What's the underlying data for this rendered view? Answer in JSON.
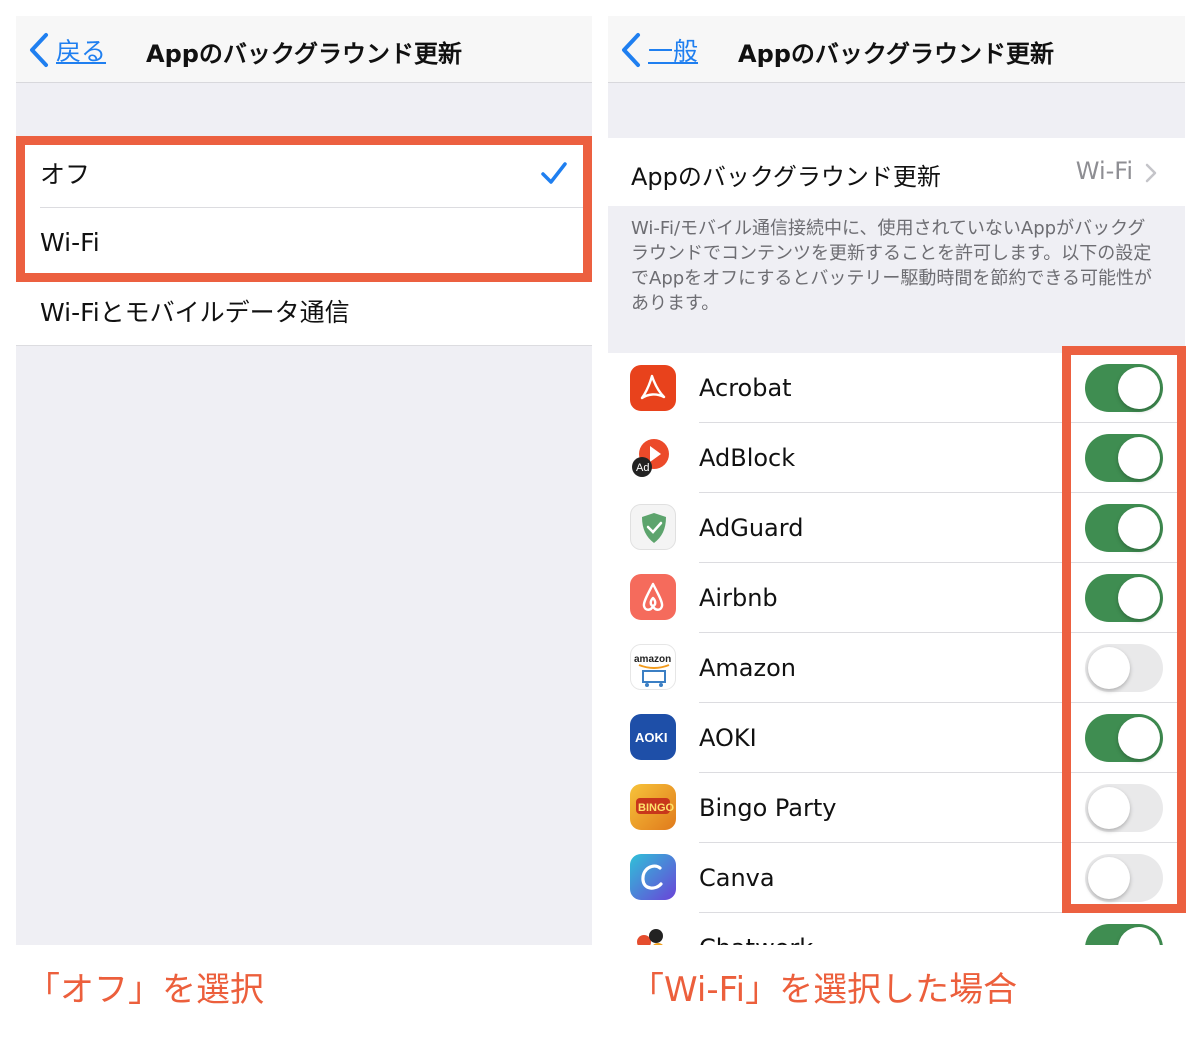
{
  "left_screen": {
    "back_label": "戻る",
    "title": "Appのバックグラウンド更新",
    "options": [
      {
        "label": "オフ",
        "checked": true
      },
      {
        "label": "Wi-Fi",
        "checked": false
      },
      {
        "label": "Wi-Fiとモバイルデータ通信",
        "checked": false
      }
    ]
  },
  "right_screen": {
    "back_label": "一般",
    "title": "Appのバックグラウンド更新",
    "setting": {
      "label": "Appのバックグラウンド更新",
      "value": "Wi-Fi"
    },
    "note": "Wi-Fi/モバイル通信接続中に、使用されていないAppがバックグラウンドでコンテンツを更新することを許可します。以下の設定でAppをオフにするとバッテリー駆動時間を節約できる可能性があります。",
    "apps": [
      {
        "name": "Acrobat",
        "enabled": true,
        "icon": "acrobat-icon"
      },
      {
        "name": "AdBlock",
        "enabled": true,
        "icon": "adblock-icon"
      },
      {
        "name": "AdGuard",
        "enabled": true,
        "icon": "adguard-icon"
      },
      {
        "name": "Airbnb",
        "enabled": true,
        "icon": "airbnb-icon"
      },
      {
        "name": "Amazon",
        "enabled": false,
        "icon": "amazon-icon"
      },
      {
        "name": "AOKI",
        "enabled": true,
        "icon": "aoki-icon"
      },
      {
        "name": "Bingo Party",
        "enabled": false,
        "icon": "bingo-party-icon"
      },
      {
        "name": "Canva",
        "enabled": false,
        "icon": "canva-icon"
      },
      {
        "name": "Chatwork",
        "enabled": true,
        "icon": "chatwork-icon"
      }
    ]
  },
  "captions": {
    "left": "「オフ」を選択",
    "right": "「Wi-Fi」を選択した場合"
  },
  "colors": {
    "accent_blue": "#1f7ff0",
    "toggle_on": "#3f8d51",
    "toggle_off": "#e9e9ea",
    "highlight_red": "#ec6040",
    "caption_red": "#ec5f3c"
  }
}
